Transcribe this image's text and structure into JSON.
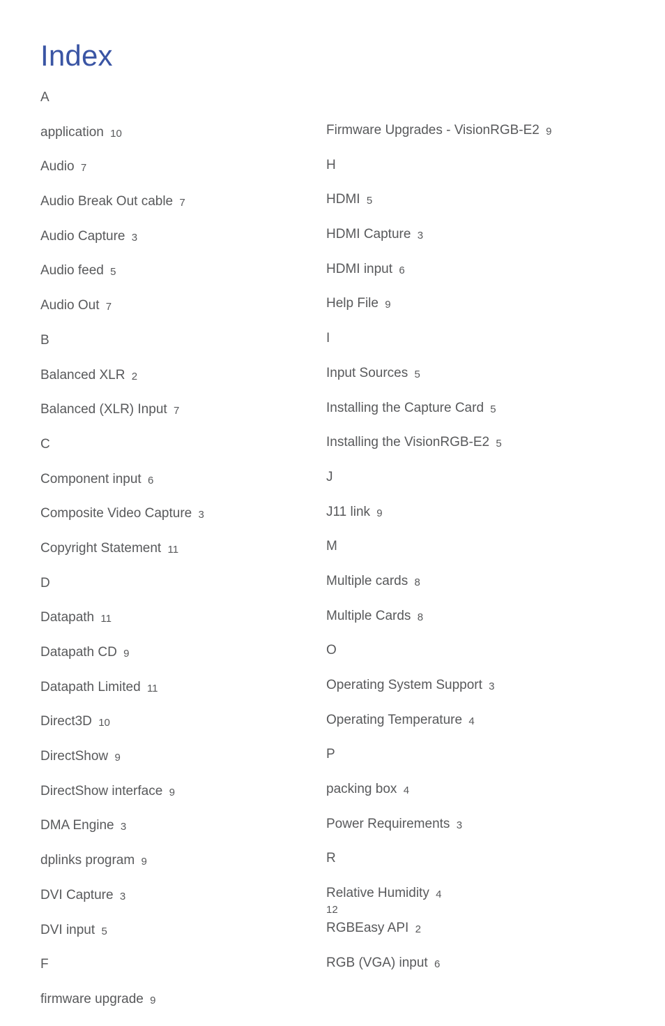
{
  "title": "Index",
  "page_number": "12",
  "left": [
    {
      "type": "letter",
      "text": "A"
    },
    {
      "type": "entry",
      "term": "application",
      "page": "10"
    },
    {
      "type": "entry",
      "term": "Audio",
      "page": "7"
    },
    {
      "type": "entry",
      "term": "Audio Break Out cable",
      "page": "7"
    },
    {
      "type": "entry",
      "term": "Audio Capture",
      "page": "3"
    },
    {
      "type": "entry",
      "term": "Audio feed",
      "page": "5"
    },
    {
      "type": "entry",
      "term": "Audio Out",
      "page": "7"
    },
    {
      "type": "letter",
      "text": "B"
    },
    {
      "type": "entry",
      "term": "Balanced XLR",
      "page": "2"
    },
    {
      "type": "entry",
      "term": "Balanced (XLR) Input",
      "page": "7"
    },
    {
      "type": "letter",
      "text": "C"
    },
    {
      "type": "entry",
      "term": "Component input",
      "page": "6"
    },
    {
      "type": "entry",
      "term": "Composite Video Capture",
      "page": "3"
    },
    {
      "type": "entry",
      "term": "Copyright Statement",
      "page": "11"
    },
    {
      "type": "letter",
      "text": "D"
    },
    {
      "type": "entry",
      "term": "Datapath",
      "page": "11"
    },
    {
      "type": "entry",
      "term": "Datapath CD",
      "page": "9"
    },
    {
      "type": "entry",
      "term": "Datapath Limited",
      "page": "11"
    },
    {
      "type": "entry",
      "term": "Direct3D",
      "page": "10"
    },
    {
      "type": "entry",
      "term": "DirectShow",
      "page": "9"
    },
    {
      "type": "entry",
      "term": "DirectShow interface",
      "page": "9"
    },
    {
      "type": "entry",
      "term": "DMA Engine",
      "page": "3"
    },
    {
      "type": "entry",
      "term": "dplinks program",
      "page": "9"
    },
    {
      "type": "entry",
      "term": "DVI Capture",
      "page": "3"
    },
    {
      "type": "entry",
      "term": "DVI input",
      "page": "5"
    },
    {
      "type": "letter",
      "text": "F"
    },
    {
      "type": "entry",
      "term": "firmware upgrade",
      "page": "9"
    }
  ],
  "right": [
    {
      "type": "entry",
      "term": "Firmware Upgrades - VisionRGB-E2",
      "page": "9"
    },
    {
      "type": "letter",
      "text": "H"
    },
    {
      "type": "entry",
      "term": "HDMI",
      "page": "5"
    },
    {
      "type": "entry",
      "term": "HDMI Capture",
      "page": "3"
    },
    {
      "type": "entry",
      "term": "HDMI input",
      "page": "6"
    },
    {
      "type": "entry",
      "term": "Help File",
      "page": "9"
    },
    {
      "type": "letter",
      "text": "I"
    },
    {
      "type": "entry",
      "term": "Input Sources",
      "page": "5"
    },
    {
      "type": "entry",
      "term": "Installing the Capture Card",
      "page": "5"
    },
    {
      "type": "entry",
      "term": "Installing the VisionRGB-E2",
      "page": "5"
    },
    {
      "type": "letter",
      "text": "J"
    },
    {
      "type": "entry",
      "term": "J11 link",
      "page": "9"
    },
    {
      "type": "letter",
      "text": "M"
    },
    {
      "type": "entry",
      "term": "Multiple cards",
      "page": "8"
    },
    {
      "type": "entry",
      "term": "Multiple Cards",
      "page": "8"
    },
    {
      "type": "letter",
      "text": "O"
    },
    {
      "type": "entry",
      "term": "Operating System Support",
      "page": "3"
    },
    {
      "type": "entry",
      "term": "Operating Temperature",
      "page": "4"
    },
    {
      "type": "letter",
      "text": "P"
    },
    {
      "type": "entry",
      "term": "packing box",
      "page": "4"
    },
    {
      "type": "entry",
      "term": "Power Requirements",
      "page": "3"
    },
    {
      "type": "letter",
      "text": "R"
    },
    {
      "type": "entry",
      "term": "Relative Humidity",
      "page": "4"
    },
    {
      "type": "entry",
      "term": "RGBEasy API",
      "page": "2"
    },
    {
      "type": "entry",
      "term": "RGB (VGA) input",
      "page": "6"
    }
  ]
}
